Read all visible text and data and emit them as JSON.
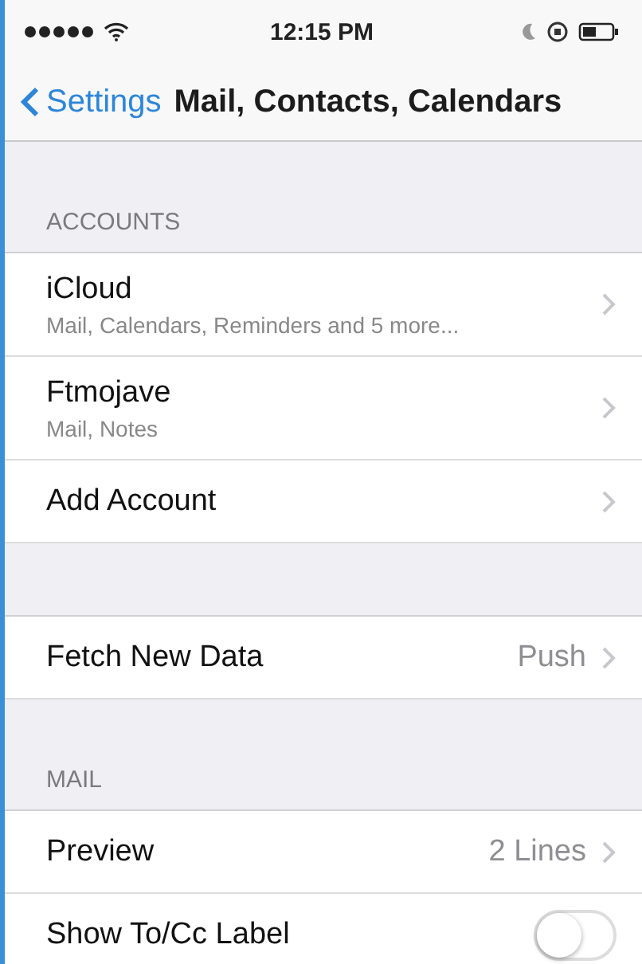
{
  "status_bar": {
    "time": "12:15 PM"
  },
  "nav_bar": {
    "back": "Settings",
    "title": "Mail, Contacts, Calendars"
  },
  "sections": [
    {
      "kind": "header",
      "label": "ACCOUNTS"
    },
    {
      "kind": "nav",
      "title": "iCloud",
      "subtitle": "Mail, Calendars, Reminders and 5 more..."
    },
    {
      "kind": "nav",
      "title": "Ftmojave",
      "subtitle": "Mail, Notes"
    },
    {
      "kind": "nav",
      "title": "Add Account"
    },
    {
      "kind": "spacer"
    },
    {
      "kind": "nav",
      "title": "Fetch New Data",
      "value": "Push"
    },
    {
      "kind": "header",
      "label": "MAIL"
    },
    {
      "kind": "nav",
      "title": "Preview",
      "value": "2 Lines"
    },
    {
      "kind": "toggle",
      "title": "Show To/Cc Label",
      "on": false
    }
  ]
}
